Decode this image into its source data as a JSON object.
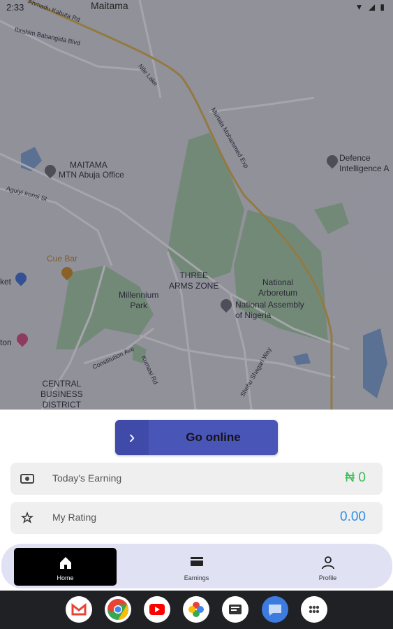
{
  "status_bar": {
    "time": "2:33",
    "location": "Maitama"
  },
  "map": {
    "labels": {
      "road_ahmadu": "Ahmadu Kabuta Rd",
      "road_ibrahim": "Ibrahim Babangida Blvd",
      "road_nile": "Nile Lake",
      "road_murtala": "Murtala Mohammed Exp",
      "road_aguiyi": "Aguiyi Ironsi St",
      "road_constitution": "Constitution Ave",
      "road_kumasi": "Kumasi Rd",
      "road_shehu": "Shehu Shagari Way",
      "maitama": "MAITAMA",
      "mtn": "MTN Abuja Office",
      "defence": "Defence\nIntelligence A",
      "cue_bar": "Cue Bar",
      "three_arms": "THREE\nARMS ZONE",
      "millennium": "Millennium\nPark",
      "arboretum": "National\nArboretum",
      "assembly": "National Assembly\nof Nigeria",
      "market": "ket",
      "hilton": "ton",
      "cbd": "CENTRAL\nBUSINESS\nDISTRICT"
    }
  },
  "go_online": {
    "label": "Go online"
  },
  "cards": {
    "earning": {
      "label": "Today's Earning",
      "value": "₦ 0",
      "color": "#3dbd5a"
    },
    "rating": {
      "label": "My Rating",
      "value": "0.00",
      "color": "#2d8de6"
    }
  },
  "nav": {
    "home": "Home",
    "earnings": "Earnings",
    "profile": "Profile"
  },
  "dock_apps": [
    "gmail-icon",
    "chrome-icon",
    "youtube-icon",
    "photos-icon",
    "news-icon",
    "messages-icon",
    "apps-icon"
  ]
}
